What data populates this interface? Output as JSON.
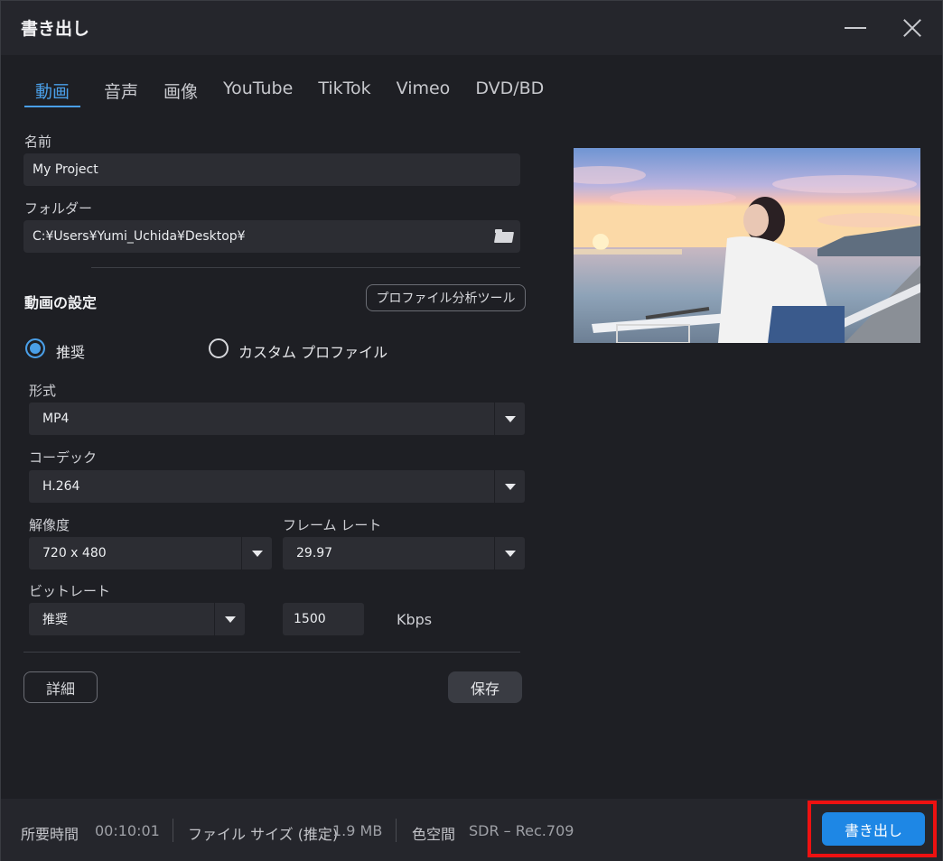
{
  "window": {
    "title": "書き出し"
  },
  "tabs": [
    {
      "label": "動画",
      "active": true
    },
    {
      "label": "音声"
    },
    {
      "label": "画像"
    },
    {
      "label": "YouTube"
    },
    {
      "label": "TikTok"
    },
    {
      "label": "Vimeo"
    },
    {
      "label": "DVD/BD"
    }
  ],
  "name": {
    "label": "名前",
    "value": "My Project"
  },
  "folder": {
    "label": "フォルダー",
    "value": "C:¥Users¥Yumi_Uchida¥Desktop¥",
    "icon": "folder-open-icon"
  },
  "video_settings": {
    "title": "動画の設定",
    "profile_tool_label": "プロファイル分析ツール",
    "recommended_label": "推奨",
    "custom_profile_label": "カスタム プロファイル",
    "selected_profile": "推奨"
  },
  "format": {
    "label": "形式",
    "value": "MP4"
  },
  "codec": {
    "label": "コーデック",
    "value": "H.264"
  },
  "resolution": {
    "label": "解像度",
    "value": "720 x 480"
  },
  "frame_rate": {
    "label": "フレーム レート",
    "value": "29.97"
  },
  "bitrate": {
    "label": "ビットレート",
    "mode": "推奨",
    "value": "1500",
    "unit": "Kbps"
  },
  "buttons": {
    "details": "詳細",
    "save": "保存",
    "export": "書き出し"
  },
  "footer": {
    "time_label": "所要時間",
    "time_value": "00:10:01",
    "size_label": "ファイル サイズ (推定)",
    "size_value": "1.9 MB",
    "color_label": "色空間",
    "color_value": "SDR – Rec.709"
  },
  "colors": {
    "accent": "#1e87e5",
    "tab_active": "#4a9fe8",
    "highlight": "#ee1111"
  }
}
